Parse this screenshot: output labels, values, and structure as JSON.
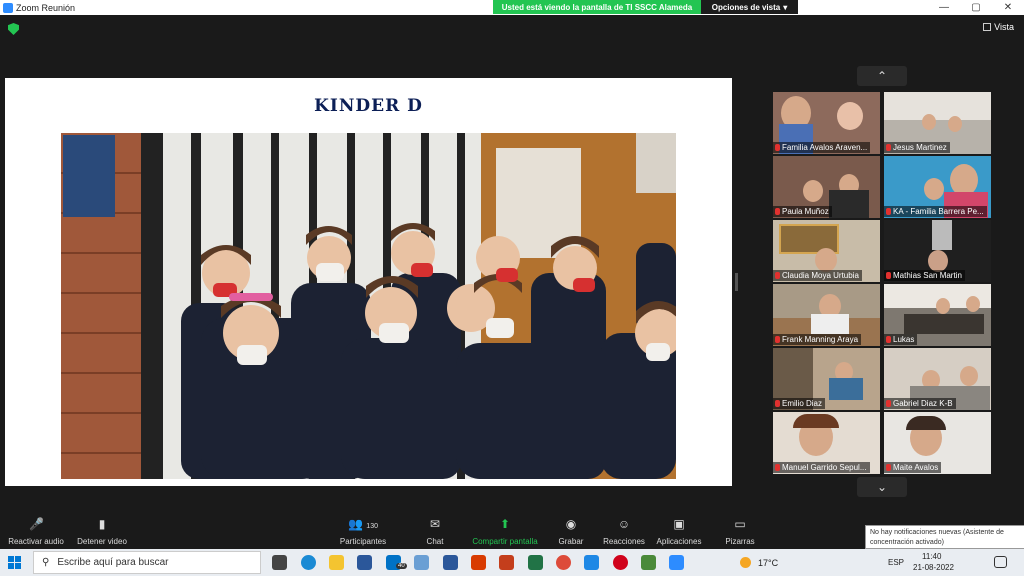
{
  "window": {
    "title": "Zoom Reunión",
    "controls": [
      "—",
      "▢",
      "✕"
    ]
  },
  "share_banner": {
    "text": "Usted está viendo la pantalla de TI SSCC Alameda",
    "view_options": "Opciones de vista"
  },
  "view_button": "Vista",
  "slide": {
    "title": "KINDER  D"
  },
  "participants": [
    {
      "name": "Familia Avalos Araven..."
    },
    {
      "name": "Jesus Martinez"
    },
    {
      "name": "Paula Muñoz"
    },
    {
      "name": "KA - Familia Barrera Pe..."
    },
    {
      "name": "Claudia Moya Urtubia"
    },
    {
      "name": "Mathias San Martin"
    },
    {
      "name": "Frank Manning Araya"
    },
    {
      "name": "Lukas"
    },
    {
      "name": "Emilio Diaz"
    },
    {
      "name": "Gabriel Diaz K-B"
    },
    {
      "name": "Manuel Garrido Sepul..."
    },
    {
      "name": "Maite Avalos"
    }
  ],
  "toolbar": {
    "audio": "Reactivar audio",
    "video": "Detener video",
    "participants": "Participantes",
    "participants_count": "130",
    "chat": "Chat",
    "share": "Compartir pantalla",
    "record": "Grabar",
    "reactions": "Reacciones",
    "apps": "Aplicaciones",
    "whiteboards": "Pizarras"
  },
  "notification": "No hay notificaciones nuevas (Asistente de concentración activado)",
  "taskbar": {
    "search_placeholder": "Escribe aquí para buscar",
    "mail_badge": "40",
    "temperature": "17°C",
    "language": "ESP",
    "time": "11:40",
    "date": "21-08-2022"
  },
  "colors": {
    "accent_green": "#23c552",
    "slide_title": "#0c1f56",
    "muted_red": "#e2312f"
  }
}
